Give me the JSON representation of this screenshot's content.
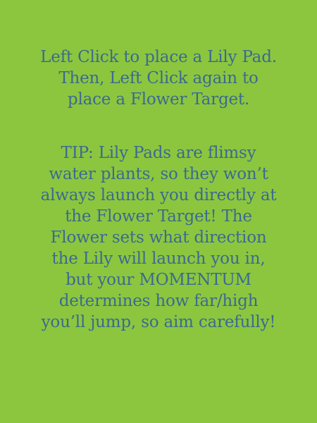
{
  "background_color": "#8cc63f",
  "text_color": "#3b6a8f",
  "instructions": {
    "lines": [
      "Left Click to place a Lily Pad.",
      "Then, Left Click again to",
      "place a Flower Target."
    ]
  },
  "tip": {
    "lines": [
      "TIP: Lily Pads are flimsy",
      "water plants, so they won’t",
      "always launch you directly at",
      "the Flower Target! The",
      "Flower sets what direction",
      "the Lily will launch you in,",
      "but your MOMENTUM",
      "determines how far/high",
      "you’ll jump, so aim carefully!"
    ]
  }
}
